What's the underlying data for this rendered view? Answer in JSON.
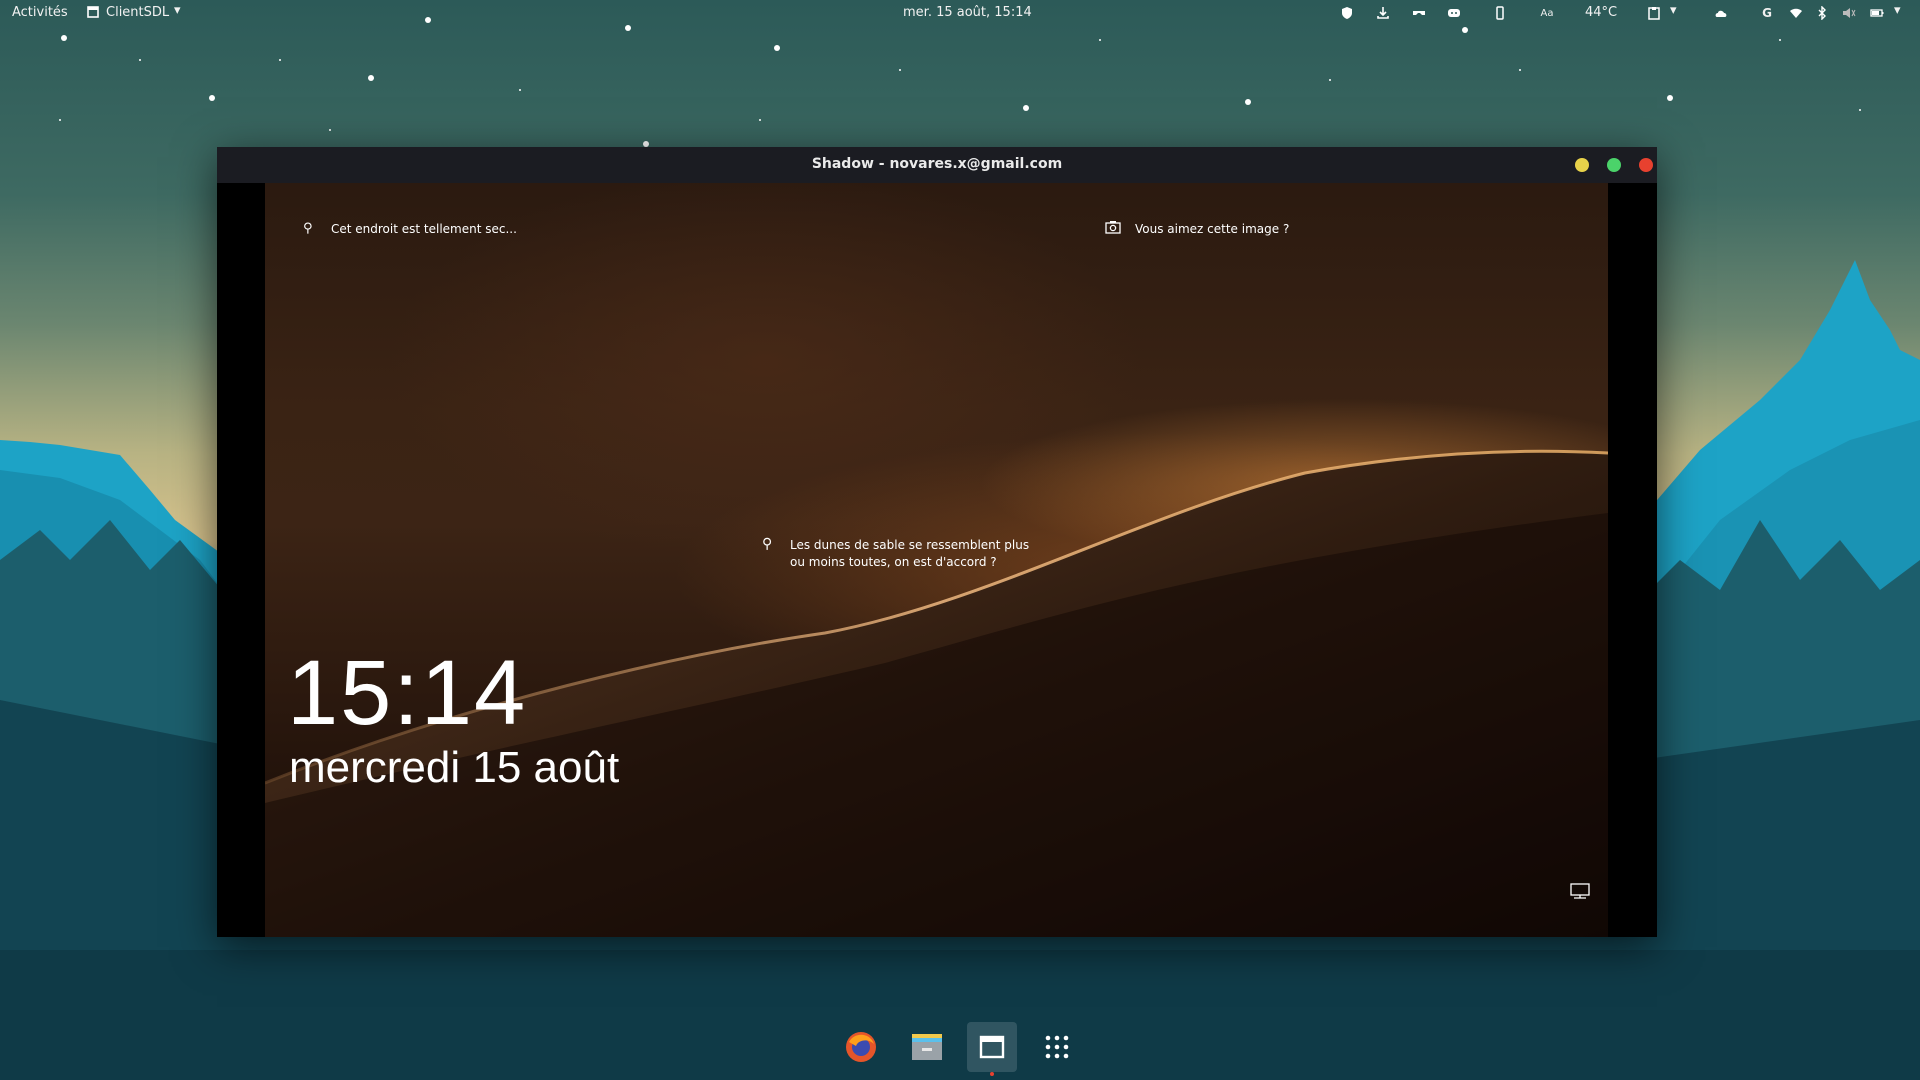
{
  "topbar": {
    "activities_label": "Activités",
    "app_menu_label": "ClientSDL",
    "clock": "mer. 15 août, 15:14",
    "temperature": "44°C",
    "tray_icons": [
      "shield-icon",
      "download-icon",
      "game-controller-icon",
      "discord-icon",
      "phone-icon",
      "font-icon",
      "clipboard-icon",
      "cloud-icon",
      "google-icon",
      "wifi-icon",
      "bluetooth-icon",
      "volume-icon",
      "battery-icon"
    ]
  },
  "window": {
    "title": "Shadow - novares.x@gmail.com",
    "colors": {
      "minimize": "#e8d24a",
      "maximize": "#4bd36a",
      "close": "#e8412f"
    }
  },
  "lockscreen": {
    "top_left_hint": "Cet endroit est tellement sec...",
    "top_right_hint": "Vous aimez cette image ?",
    "center_hint_line1": "Les dunes de sable se ressemblent plus",
    "center_hint_line2": "ou moins toutes, on est d'accord ?",
    "time": "15:14",
    "date": "mercredi 15 août"
  },
  "dock": {
    "items": [
      "firefox-icon",
      "files-icon",
      "window-app-icon",
      "app-grid-icon"
    ],
    "active_index": 2
  }
}
